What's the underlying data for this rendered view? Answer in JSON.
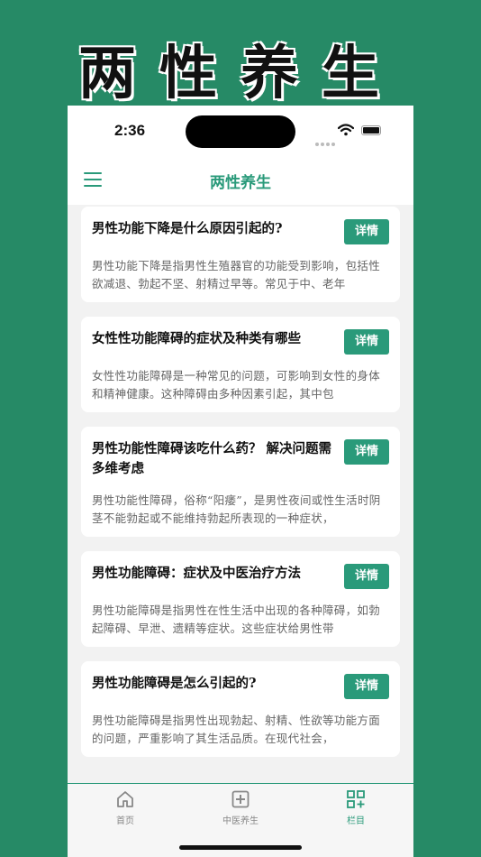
{
  "banner": {
    "title": "两性养生"
  },
  "status_bar": {
    "time": "2:36"
  },
  "nav": {
    "title": "两性养生",
    "menu_icon": "hamburger-menu-icon"
  },
  "colors": {
    "background": "#268a66",
    "accent": "#2a9a7a"
  },
  "articles": [
    {
      "title": "男性功能下降是什么原因引起的?",
      "button": "详情",
      "summary": "男性功能下降是指男性生殖器官的功能受到影响，包括性欲减退、勃起不坚、射精过早等。常见于中、老年"
    },
    {
      "title": "女性性功能障碍的症状及种类有哪些",
      "button": "详情",
      "summary": "女性性功能障碍是一种常见的问题，可影响到女性的身体和精神健康。这种障碍由多种因素引起，其中包"
    },
    {
      "title": "男性功能性障碍该吃什么药？ 解决问题需多维考虑",
      "button": "详情",
      "summary": "男性功能性障碍，俗称“阳痿”，是男性夜间或性生活时阴茎不能勃起或不能维持勃起所表现的一种症状，"
    },
    {
      "title": "男性功能障碍：症状及中医治疗方法",
      "button": "详情",
      "summary": "男性功能障碍是指男性在性生活中出现的各种障碍，如勃起障碍、早泄、遗精等症状。这些症状给男性带"
    },
    {
      "title": "男性功能障碍是怎么引起的?",
      "button": "详情",
      "summary": "男性功能障碍是指男性出现勃起、射精、性欲等功能方面的问题，严重影响了其生活品质。在现代社会，"
    }
  ],
  "tabs": [
    {
      "label": "首页",
      "icon": "home-icon",
      "active": false
    },
    {
      "label": "中医养生",
      "icon": "medical-plus-icon",
      "active": false
    },
    {
      "label": "栏目",
      "icon": "grid-plus-icon",
      "active": true
    }
  ]
}
